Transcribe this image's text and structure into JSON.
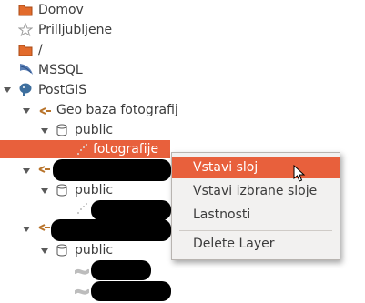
{
  "tree": {
    "domov": "Domov",
    "favorites": "Prilljubljene",
    "root": "/",
    "mssql": "MSSQL",
    "postgis": "PostGIS",
    "geo_db": "Geo baza fotografij",
    "schema1": "public",
    "layer_selected": "fotografije",
    "schema2": "public",
    "schema3": "public"
  },
  "context_menu": {
    "item1": "Vstavi sloj",
    "item2": "Vstavi izbrane sloje",
    "item3": "Lastnosti",
    "item4": "Delete Layer"
  },
  "colors": {
    "selection": "#e8603c",
    "menu_bg": "#f2f1f0"
  },
  "icons": [
    "folder-icon",
    "star-icon",
    "mssql-icon",
    "postgis-elephant-icon",
    "connection-plug-icon",
    "database-cylinder-icon",
    "point-layer-icon",
    "line-layer-icon",
    "mouse-cursor-icon"
  ]
}
